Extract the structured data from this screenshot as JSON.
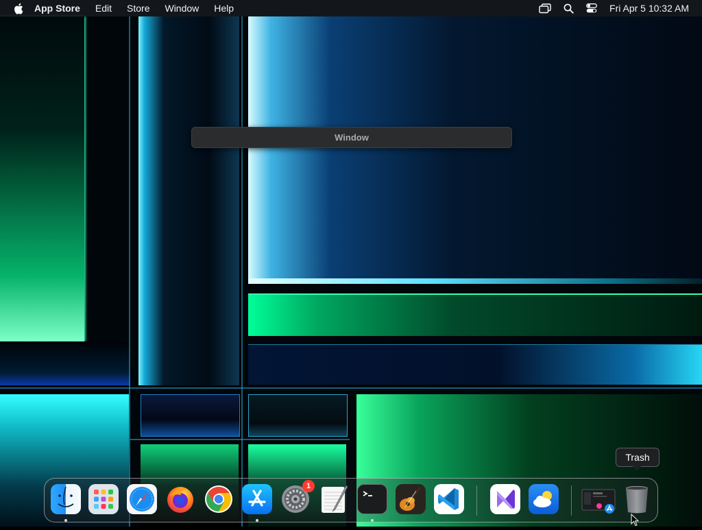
{
  "menubar": {
    "app_name": "App Store",
    "menus": [
      "Edit",
      "Store",
      "Window",
      "Help"
    ],
    "clock": "Fri Apr 5  10:32 AM"
  },
  "window_title": "Window",
  "tooltip": "Trash",
  "dock": {
    "apps": [
      {
        "name": "Finder",
        "icon": "finder-icon",
        "running": true
      },
      {
        "name": "Launchpad",
        "icon": "launchpad-icon",
        "running": false
      },
      {
        "name": "Safari",
        "icon": "safari-icon",
        "running": false
      },
      {
        "name": "Firefox",
        "icon": "firefox-icon",
        "running": false
      },
      {
        "name": "Chrome",
        "icon": "chrome-icon",
        "running": false
      },
      {
        "name": "App Store",
        "icon": "app-store-icon",
        "running": true
      },
      {
        "name": "System Settings",
        "icon": "system-settings-icon",
        "running": false,
        "badge": "1"
      },
      {
        "name": "TextEdit",
        "icon": "textedit-icon",
        "running": false
      },
      {
        "name": "Terminal",
        "icon": "terminal-icon",
        "running": true
      },
      {
        "name": "GarageBand",
        "icon": "garageband-icon",
        "running": false
      },
      {
        "name": "VS Code",
        "icon": "vscode-icon",
        "running": false
      },
      {
        "name": "Visual Studio",
        "icon": "visual-studio-icon",
        "running": false
      },
      {
        "name": "Weather",
        "icon": "weather-icon",
        "running": false
      },
      {
        "name": "Downloads Stack",
        "icon": "stack-icon",
        "running": false
      },
      {
        "name": "Trash",
        "icon": "trash-icon",
        "running": false
      }
    ]
  },
  "colors": {
    "menubar_bg": "#181c20",
    "badge": "#ff3b30",
    "accent_cyan": "#3fe0ff",
    "accent_green": "#20ff9a"
  }
}
